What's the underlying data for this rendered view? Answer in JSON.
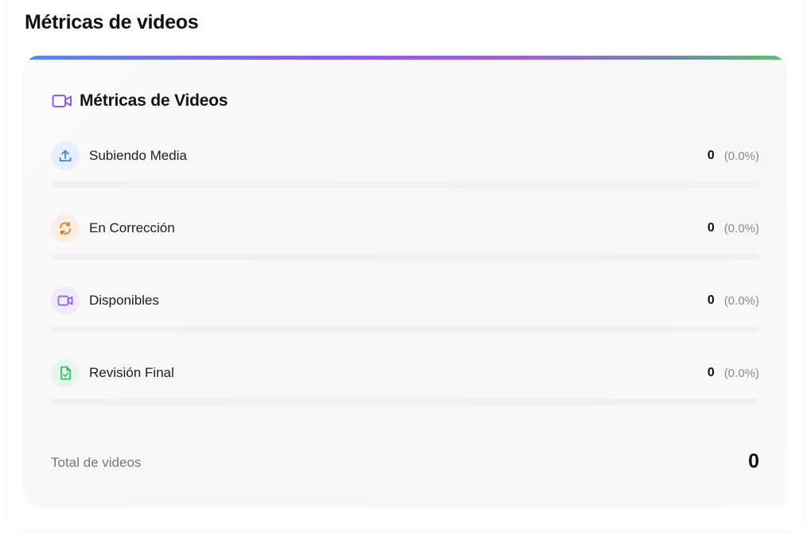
{
  "page": {
    "title": "Métricas de videos"
  },
  "card": {
    "title": "Métricas de Videos",
    "header_icon": "video-icon",
    "accent_gradient": [
      "#5b8ae6",
      "#8b5be9",
      "#9e62d8",
      "#6f8aa6",
      "#5fbf6f"
    ],
    "rows": [
      {
        "label": "Subiendo Media",
        "icon": "upload-icon",
        "color": "#3b82f6",
        "badge_bg": "#e7effd",
        "count": "0",
        "percent": "(0.0%)",
        "fraction": 0
      },
      {
        "label": "En Corrección",
        "icon": "refresh-icon",
        "color": "#f97316",
        "badge_bg": "#fdeee3",
        "count": "0",
        "percent": "(0.0%)",
        "fraction": 0
      },
      {
        "label": "Disponibles",
        "icon": "video-icon",
        "color": "#8b5cf6",
        "badge_bg": "#f1eafd",
        "count": "0",
        "percent": "(0.0%)",
        "fraction": 0
      },
      {
        "label": "Revisión Final",
        "icon": "file-check-icon",
        "color": "#22c55e",
        "badge_bg": "#e7f6ea",
        "count": "0",
        "percent": "(0.0%)",
        "fraction": 0
      }
    ],
    "total": {
      "label": "Total de videos",
      "value": "0"
    }
  }
}
